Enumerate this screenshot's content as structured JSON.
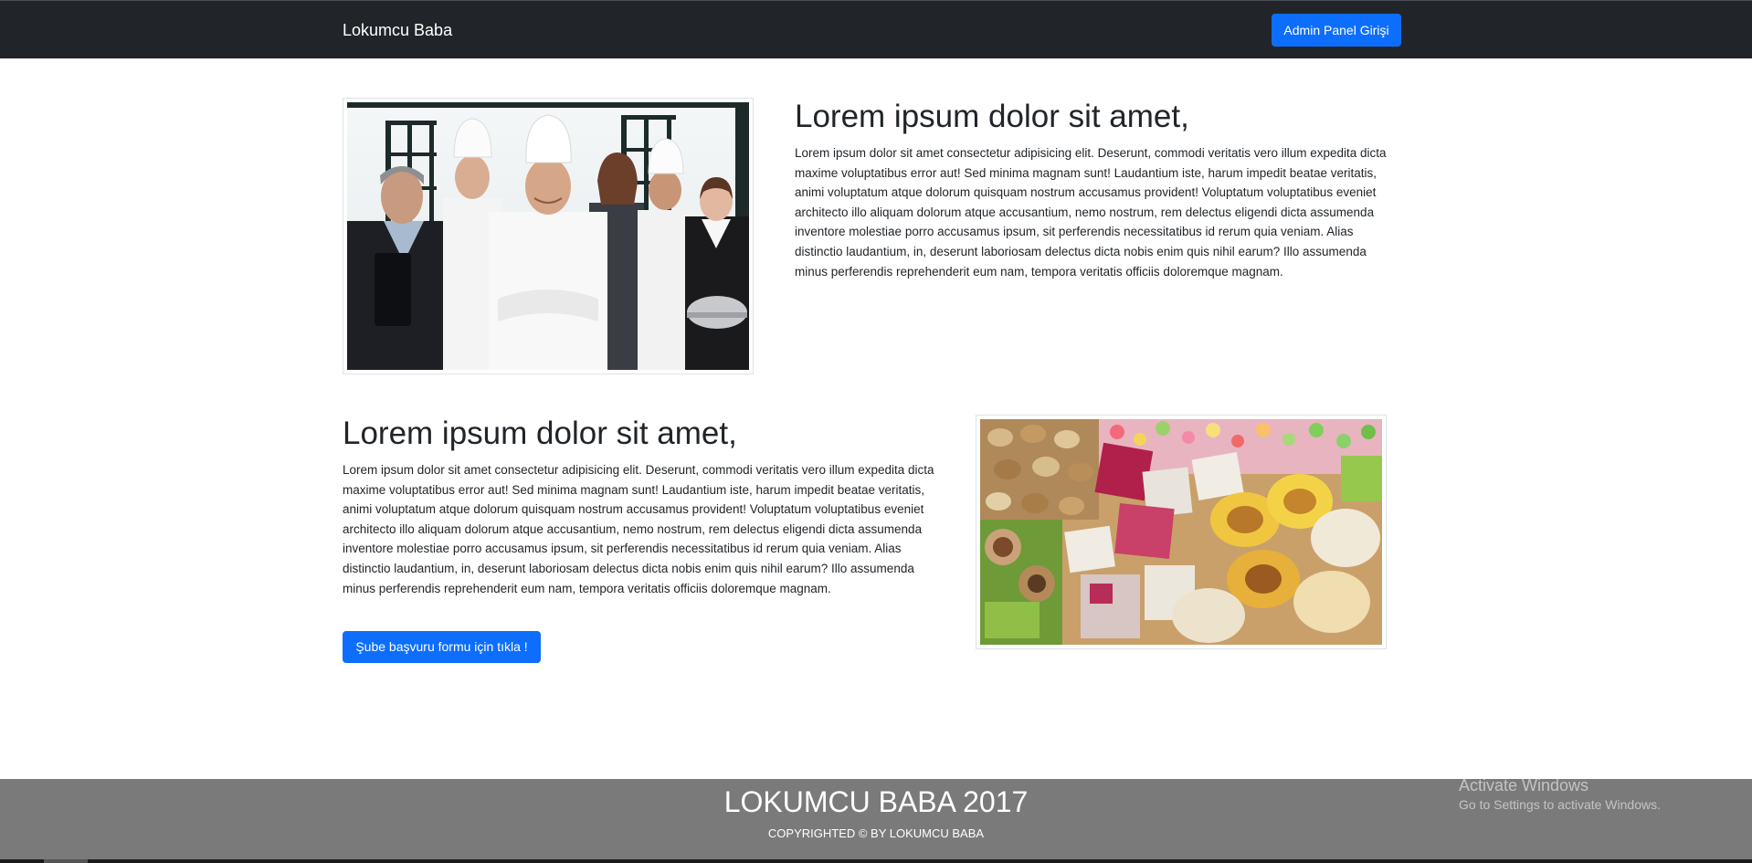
{
  "navbar": {
    "brand": "Lokumcu Baba",
    "admin_button_label": "Admin Panel Girişi"
  },
  "section_1": {
    "image_icon": "staff-photo-icon",
    "title": "Lorem ipsum dolor sit amet,",
    "text": "Lorem ipsum dolor sit amet consectetur adipisicing elit. Deserunt, commodi veritatis vero illum expedita dicta maxime voluptatibus error aut! Sed minima magnam sunt! Laudantium iste, harum impedit beatae veritatis, animi voluptatum atque dolorum quisquam nostrum accusamus provident! Voluptatum voluptatibus eveniet architecto illo aliquam dolorum atque accusantium, nemo nostrum, rem delectus eligendi dicta assumenda inventore molestiae porro accusamus ipsum, sit perferendis necessitatibus id rerum quia veniam. Alias distinctio laudantium, in, deserunt laboriosam delectus dicta nobis enim quis nihil earum? Illo assumenda minus perferendis reprehenderit eum nam, tempora veritatis officiis doloremque magnam."
  },
  "section_2": {
    "image_icon": "turkish-delight-photo-icon",
    "title": "Lorem ipsum dolor sit amet,",
    "text": "Lorem ipsum dolor sit amet consectetur adipisicing elit. Deserunt, commodi veritatis vero illum expedita dicta maxime voluptatibus error aut! Sed minima magnam sunt! Laudantium iste, harum impedit beatae veritatis, animi voluptatum atque dolorum quisquam nostrum accusamus provident! Voluptatum voluptatibus eveniet architecto illo aliquam dolorum atque accusantium, nemo nostrum, rem delectus eligendi dicta assumenda inventore molestiae porro accusamus ipsum, sit perferendis necessitatibus id rerum quia veniam. Alias distinctio laudantium, in, deserunt laboriosam delectus dicta nobis enim quis nihil earum? Illo assumenda minus perferendis reprehenderit eum nam, tempora veritatis officiis doloremque magnam.",
    "button_label": "Şube başvuru formu için tıkla !"
  },
  "footer": {
    "title": "LOKUMCU BABA 2017",
    "copyright": "COPYRIGHTED © BY LOKUMCU BABA"
  },
  "watermark": {
    "title": "Activate Windows",
    "subtitle": "Go to Settings to activate Windows."
  },
  "colors": {
    "navbar_bg": "#212529",
    "primary": "#0d6efd",
    "footer_bg": "#7a7a7a",
    "text": "#212529"
  }
}
